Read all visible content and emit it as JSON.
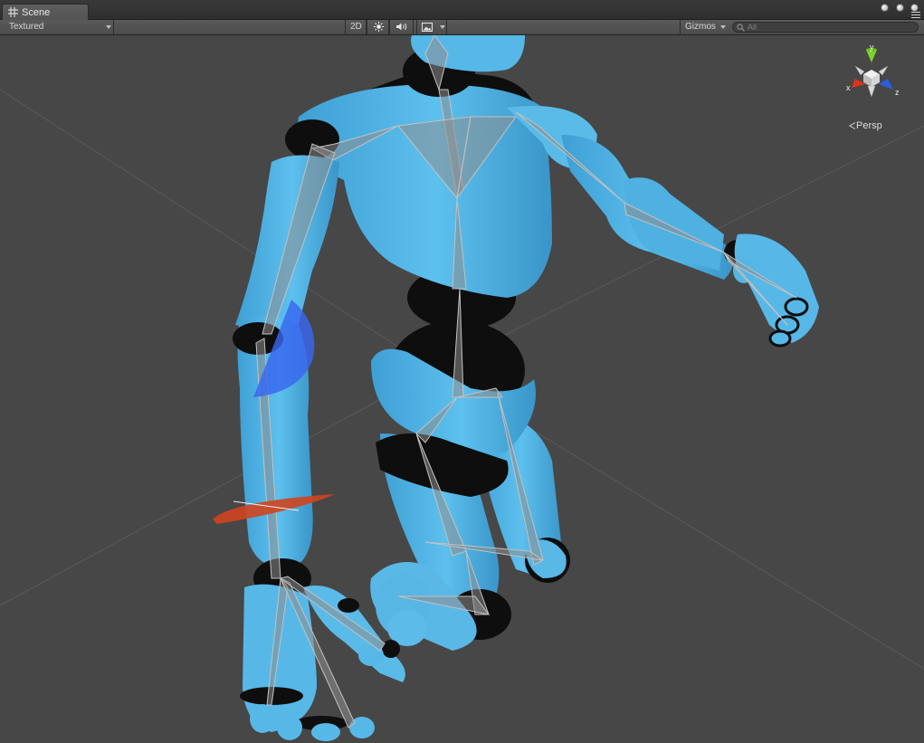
{
  "tab": {
    "label": "Scene"
  },
  "toolbar": {
    "render_mode": "Textured",
    "mode_2d": "2D",
    "gizmos_label": "Gizmos",
    "search_placeholder": "All"
  },
  "gizmo": {
    "axis_x": "x",
    "axis_y": "y",
    "axis_z": "z",
    "projection": "Persp"
  },
  "colors": {
    "body": "#55b8e8",
    "joint": "#0e0e0e",
    "bone": "#9a9a9a",
    "gizmo_x": "#e0341a",
    "gizmo_y": "#7bd32a",
    "gizmo_z": "#2d5ddc",
    "rotate_blue": "#3866f0",
    "rotate_red": "#d0441e"
  }
}
